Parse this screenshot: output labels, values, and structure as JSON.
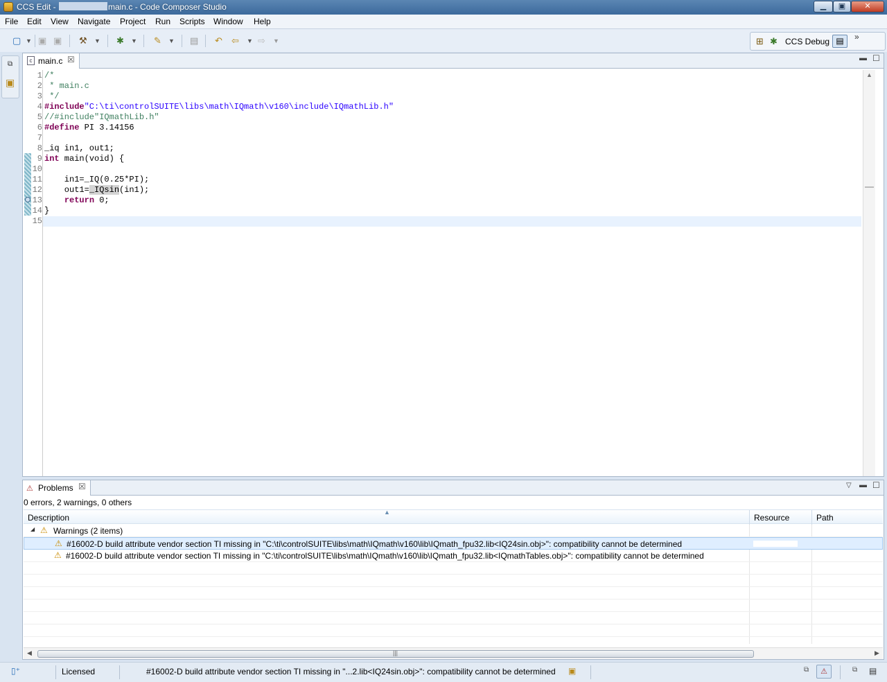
{
  "window": {
    "title_prefix": "CCS Edit - ",
    "title_suffix": "main.c - Code Composer Studio",
    "minimize": "▁",
    "maximize": "▣",
    "close": "✕"
  },
  "menu": [
    "File",
    "Edit",
    "View",
    "Navigate",
    "Project",
    "Run",
    "Scripts",
    "Window",
    "Help"
  ],
  "toolbar": {
    "perspective_label": "CCS Debug",
    "more": "»"
  },
  "editor": {
    "tab_label": "main.c",
    "lines": [
      {
        "n": "1",
        "segs": [
          {
            "c": "cmt",
            "t": "/*"
          }
        ]
      },
      {
        "n": "2",
        "segs": [
          {
            "c": "cmt",
            "t": " * main.c"
          }
        ]
      },
      {
        "n": "3",
        "segs": [
          {
            "c": "cmt",
            "t": " */"
          }
        ]
      },
      {
        "n": "4",
        "segs": [
          {
            "c": "pp",
            "t": "#include"
          },
          {
            "c": "str",
            "t": "\"C:\\ti\\controlSUITE\\libs\\math\\IQmath\\v160\\include\\IQmathLib.h\""
          }
        ]
      },
      {
        "n": "5",
        "segs": [
          {
            "c": "cmt",
            "t": "//#include\"IQmathLib.h\""
          }
        ]
      },
      {
        "n": "6",
        "segs": [
          {
            "c": "pp",
            "t": "#define"
          },
          {
            "c": "",
            "t": " PI 3.14156"
          }
        ]
      },
      {
        "n": "7",
        "segs": []
      },
      {
        "n": "8",
        "segs": [
          {
            "c": "",
            "t": "_iq in1, out1;"
          }
        ]
      },
      {
        "n": "9",
        "segs": [
          {
            "c": "kw",
            "t": "int"
          },
          {
            "c": "",
            "t": " main(void) {"
          }
        ]
      },
      {
        "n": "10",
        "segs": []
      },
      {
        "n": "11",
        "segs": [
          {
            "c": "",
            "t": "    in1=_IQ(0.25*PI);"
          }
        ]
      },
      {
        "n": "12",
        "segs": [
          {
            "c": "",
            "t": "    out1="
          },
          {
            "c": "hl",
            "t": "_IQsin"
          },
          {
            "c": "",
            "t": "(in1);"
          }
        ]
      },
      {
        "n": "13",
        "segs": [
          {
            "c": "",
            "t": "    "
          },
          {
            "c": "kw",
            "t": "return"
          },
          {
            "c": "",
            "t": " 0;"
          }
        ]
      },
      {
        "n": "14",
        "segs": [
          {
            "c": "",
            "t": "}"
          }
        ]
      },
      {
        "n": "15",
        "segs": []
      }
    ]
  },
  "problems": {
    "tab_label": "Problems",
    "summary": "0 errors, 2 warnings, 0 others",
    "columns": {
      "description": "Description",
      "resource": "Resource",
      "path": "Path"
    },
    "group_label": "Warnings (2 items)",
    "items": [
      {
        "description": "#16002-D build attribute vendor section TI missing in \"C:\\ti\\controlSUITE\\libs\\math\\IQmath\\v160\\lib\\IQmath_fpu32.lib<IQ24sin.obj>\": compatibility cannot be determined",
        "selected": true
      },
      {
        "description": "#16002-D build attribute vendor section TI missing in \"C:\\ti\\controlSUITE\\libs\\math\\IQmath\\v160\\lib\\IQmath_fpu32.lib<IQmathTables.obj>\": compatibility cannot be determined",
        "selected": false
      }
    ]
  },
  "status": {
    "license": "Licensed",
    "message": "#16002-D build attribute vendor section TI missing in \"...2.lib<IQ24sin.obj>\": compatibility cannot be determined"
  },
  "colors": {
    "titlebar": "#3c6a9c",
    "selection": "#dfeeff",
    "comment": "#3f7f5f",
    "keyword": "#7f0055",
    "string": "#2a00ff",
    "warning": "#c98b00"
  }
}
